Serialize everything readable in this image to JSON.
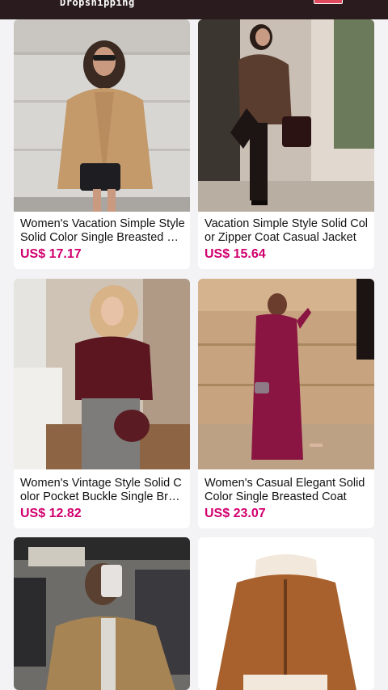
{
  "header": {
    "title": "Dropshipping"
  },
  "products": [
    {
      "title": "Women's Vacation Simple Style Solid Color Single Breasted Coat",
      "price": "US$ 17.17"
    },
    {
      "title": "Vacation Simple Style Solid Color Zipper Coat Casual Jacket",
      "price": "US$ 15.64"
    },
    {
      "title": "Women's Vintage Style Solid Color Pocket Buckle Single Breasted Coat",
      "price": "US$ 12.82"
    },
    {
      "title": "Women's Casual Elegant Solid Color Single Breasted Coat",
      "price": "US$ 23.07"
    }
  ]
}
